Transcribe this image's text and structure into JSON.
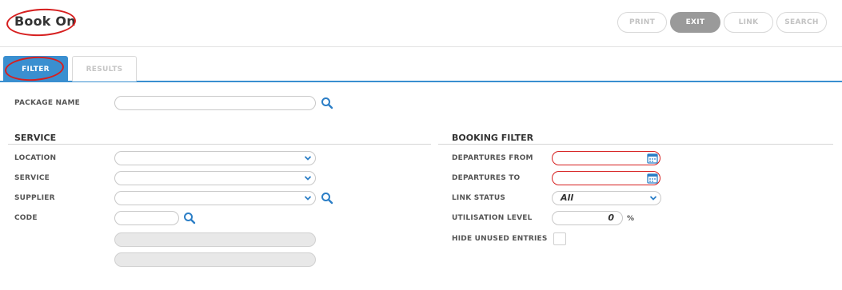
{
  "header": {
    "title": "Book On",
    "buttons": {
      "print": "PRINT",
      "exit": "EXIT",
      "link": "LINK",
      "search": "SEARCH"
    }
  },
  "tabs": {
    "filter": "FILTER",
    "results": "RESULTS"
  },
  "package": {
    "label": "PACKAGE NAME",
    "value": ""
  },
  "service_section": {
    "title": "SERVICE",
    "location_label": "LOCATION",
    "service_label": "SERVICE",
    "supplier_label": "SUPPLIER",
    "code_label": "CODE"
  },
  "booking_filter": {
    "title": "BOOKING FILTER",
    "departures_from_label": "DEPARTURES FROM",
    "departures_to_label": "DEPARTURES TO",
    "link_status_label": "LINK STATUS",
    "link_status_value": "All",
    "utilisation_label": "UTILISATION LEVEL",
    "utilisation_value": "0",
    "utilisation_unit": "%",
    "hide_unused_label": "HIDE UNUSED ENTRIES",
    "hide_unused_checked": false
  },
  "colors": {
    "accent": "#3a8fd0",
    "highlight": "#d61f1f",
    "exit_button": "#9a9a9a"
  },
  "icons": [
    "search-icon",
    "chevron-down-icon",
    "calendar-icon",
    "checkbox"
  ]
}
